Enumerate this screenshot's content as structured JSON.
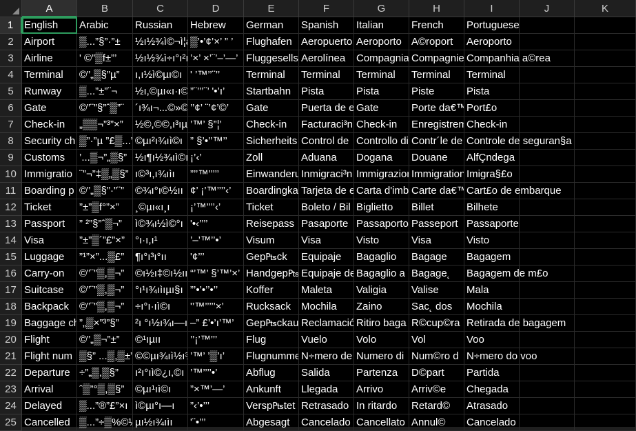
{
  "sheet": {
    "columns": [
      "A",
      "B",
      "C",
      "D",
      "E",
      "F",
      "G",
      "H",
      "I",
      "J",
      "K"
    ],
    "rows": [
      [
        "English",
        "Arabic",
        "Russian",
        "Hebrew",
        "German",
        "Spanish",
        "Italian",
        "French",
        "Portuguese",
        "",
        ""
      ],
      [
        "Airport",
        "▒...”§”·”±",
        "½ı½¾ì©¬ì¦à",
        "▒’•’¢’×’ ” ’",
        "Flughafen",
        "Aeropuerto",
        "Aeroporto",
        "A©roport",
        "Aeroporto",
        "",
        ""
      ],
      [
        "Airline",
        "' ©”▒f±”’",
        "½ı½¾ì÷ı°ı²ıı",
        "’×’ ×’¨’–’—’",
        "Fluggesells",
        "Aerolínea",
        "Compagnia",
        "Compagnie",
        "Companhia a©rea",
        "",
        ""
      ],
      [
        "Terminal",
        "©”„▒§”µ”",
        "ı,ı½ì©µı©ı",
        "' ’™’’¨’’",
        "Terminal",
        "Terminal",
        "Terminal",
        "Terminal",
        "Terminal",
        "",
        ""
      ],
      [
        "Runway",
        "▒...”±”¨¬",
        "½ı,©µı«ı·ı©",
        "”¨’’’¨’ '•’ı’",
        "Startbahn",
        "Pista",
        "Pista",
        "Piste",
        "Pista",
        "",
        ""
      ],
      [
        "Gate",
        "©”¨”§”ˆ▒”¨",
        "´ı¾ı¬...©»©ı©",
        "’’¢’ ¨’¢’©’",
        "Gate",
        "Puerta de e",
        "Gate",
        "Porte dа€™",
        "Port£o",
        "",
        ""
      ],
      [
        "Check-in",
        "„▒▒¬”³”×”",
        "½©,©©,ı³ıµıı",
        "’™’ §”¦’",
        "Check-in",
        "Facturaci³n",
        "Check-in",
        "Enregistrem",
        "Check-in",
        "",
        ""
      ],
      [
        "Security ch",
        "▒”·”µ ”£▒...”",
        "©µı²ı¾ıì©ı",
        "” §’•’’™’’",
        "Sicherheits",
        "Control de",
        "Controllo di",
        "Contr´le de",
        "Controle de seguran§a",
        "",
        ""
      ],
      [
        "Customs",
        "’...▒¬”„▒§”",
        "½ı¶ı½¾ıì©ı",
        "¡’‹’",
        "Zoll",
        "Aduana",
        "Dogana",
        "Douane",
        "AlfÇndega",
        "",
        ""
      ],
      [
        "Immigratio",
        "¨”¬”‡▒„▒§”",
        "ı©³ı,ı¾ıìı",
        "”’’™’’’’’",
        "Einwanderu",
        "Inmigraci³n",
        "Immigrazion",
        "Immigration",
        "Imigra§£o",
        "",
        ""
      ],
      [
        "Boarding p",
        "©”„▒§”·”¨”",
        "©¾ı°ı©½ıı",
        "¢’ ¡’™’’’’‹’",
        "Boardingka",
        "Tarjeta de e",
        "Carta d'imb",
        "Carte dа€™",
        "Cart£o de embarque",
        "",
        ""
      ],
      [
        "Ticket",
        "”±”▒f°”×”",
        "¸©µı«ı¸ı",
        "¡’™’’’’‹’",
        "Ticket",
        "Boleto / Bil",
        "Biglietto",
        "Billet",
        "Bilhete",
        "",
        ""
      ],
      [
        "Passport",
        "” ²”§”ˆ▒¬”",
        "ì©¾ı½ì©°ı",
        "'•‹’’’’",
        "Reisepass",
        "Pasaporte",
        "Passaporto",
        "Passeport",
        "Passaporte",
        "",
        ""
      ],
      [
        "Visa",
        "”±”▒´”£”×”",
        "°ı·ı,ı¹",
        "’–’™’’•’",
        "Visum",
        "Visa",
        "Visto",
        "Visa",
        "Visto",
        "",
        ""
      ],
      [
        "Luggage",
        "”¹”×”...▒£”",
        "¶ı°ı³ı°ıı",
        "'¢’’’",
        "Gep₧ck",
        "Equipaje",
        "Bagaglio",
        "Bagage",
        "Bagagem",
        "",
        ""
      ],
      [
        "Carry-on",
        "©”¨”▒,▒¬”",
        "©ı½ı‡©ı½ıı",
        "“’™’ §’™’×’",
        "Handgep₧c",
        "Equipaje de",
        "Bagaglio a",
        "Bagage˛",
        "Bagagem de m£o",
        "",
        ""
      ],
      [
        "Suitcase",
        "©”¨”▒,▒¬”",
        "°ı¹ı¾ıìıµı§ı",
        "”’•’•’’•’’",
        "Koffer",
        "Maleta",
        "Valigia",
        "Valise",
        "Mala",
        "",
        ""
      ],
      [
        "Backpack",
        "©”¨”▒,▒¬”",
        "÷ı°ı·ıì©ı",
        "'’™’’’’’×’",
        "Rucksack",
        "Mochila",
        "Zaino",
        "Sac˛ dos",
        "Mochila",
        "",
        ""
      ],
      [
        "Baggage ch",
        "”„▒×”³”§”",
        "²ı °ı½ı¾ı—ı",
        "–” £’•’ı’™’",
        "Gep₧ckau",
        "Reclamació",
        "Ritiro baga",
        "R©cup©ra",
        "Retirada de bagagem",
        "",
        ""
      ],
      [
        "Flight",
        "©”„▒¬”±”",
        "©¹ıµıı",
        "’’¡’™’’’",
        "Flug",
        "Vuelo",
        "Volo",
        "Vol",
        "Voo",
        "",
        ""
      ],
      [
        "Flight num",
        "▒§” ...▒,▒±”",
        "©©µı¾ıì½ı¾ı",
        "’™’ ’▒’ı’",
        "Flugnumme",
        "N÷mero de",
        "Numero di",
        "Num©ro d",
        "N÷mero do voo",
        "",
        ""
      ],
      [
        "Departure",
        "÷”„▒,▒§”",
        "ı²ı°ıì©¿ı,©ı",
        "’™’’’’•’",
        "Abflug",
        "Salida",
        "Partenza",
        "D©part",
        "Partida",
        "",
        ""
      ],
      [
        "Arrival",
        "ˆ▒”°▒,▒§”",
        "©µı¹ıì©ı",
        "”×™’—’",
        "Ankunft",
        "Llegada",
        "Arrivo",
        "Arriv©e",
        "Chegada",
        "",
        ""
      ],
      [
        "Delayed",
        "▒...”®”£”×ı",
        "ì©µı°ı—ı",
        "”‹’•’’’",
        "Versp₧tet",
        "Retrasado",
        "In ritardo",
        "Retard©",
        "Atrasado",
        "",
        ""
      ],
      [
        "Cancelled",
        "▒...”÷▒%©½ı",
        "µı½ı¾ıìı",
        "'¨•’’’",
        "Abgesagt",
        "Cancelado",
        "Cancellato",
        "Annul©",
        "Cancelado",
        "",
        ""
      ]
    ]
  },
  "active_cell": "A1"
}
